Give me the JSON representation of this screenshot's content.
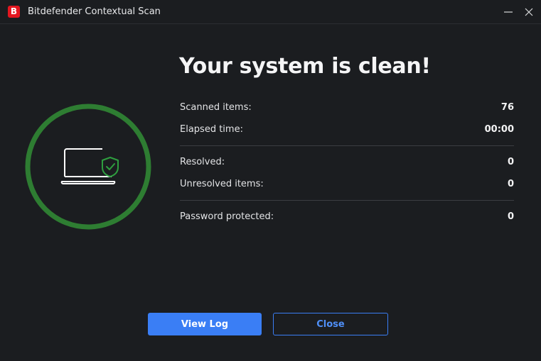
{
  "window": {
    "app_logo_letter": "B",
    "title": "Bitdefender Contextual Scan",
    "minimize_icon": "minimize-icon",
    "close_icon": "close-icon"
  },
  "status": {
    "headline": "Your system is clean!",
    "ring_color": "#2e7d32",
    "shield_color": "#2e9e3f"
  },
  "stats": {
    "scanned": {
      "label": "Scanned items:",
      "value": "76"
    },
    "elapsed": {
      "label": "Elapsed time:",
      "value": "00:00"
    },
    "resolved": {
      "label": "Resolved:",
      "value": "0"
    },
    "unresolved": {
      "label": "Unresolved items:",
      "value": "0"
    },
    "password_protected": {
      "label": "Password protected:",
      "value": "0"
    }
  },
  "buttons": {
    "view_log": "View Log",
    "close": "Close"
  },
  "colors": {
    "background": "#1b1d20",
    "accent": "#3a7ef5",
    "brand": "#e3161f"
  }
}
